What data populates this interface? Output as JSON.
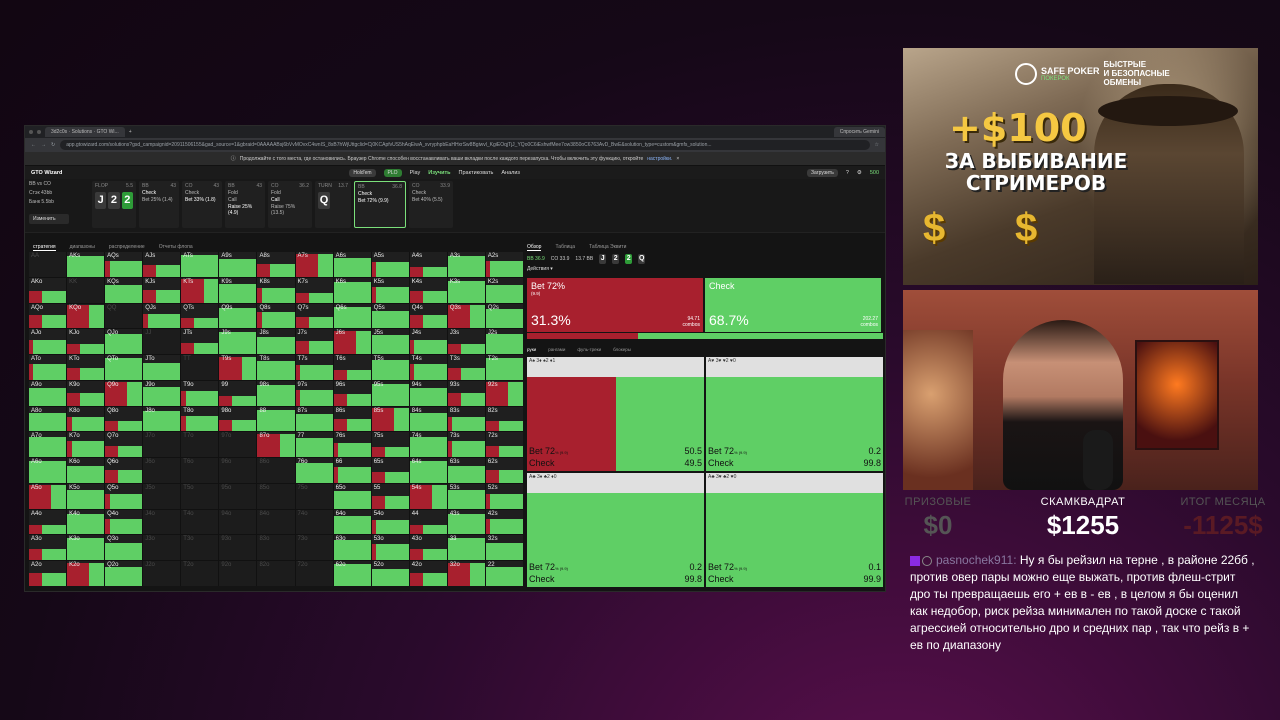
{
  "browser": {
    "tabs": [
      "3d2c0s · Solutions · GTO Wi...",
      "Спросить Gemini"
    ],
    "url": "app.gtowizard.com/solutions?gsd_campaignid=20911506155&gad_source=1&gbraid=0AAAAABsj6bVvMOvxC4wnIS_8sB7hWjUttgclid=Cj0KCApfvUS5hAqEiwA_xvryphpbEaHHxrSw8Bgiwvl_KgiEOqjTjJ_YQo0C6iEshwfMee7ow3850oC6763AvD_BwE&solution_type=custom&gmfs_solution..."
  },
  "infobar": {
    "text": "Продолжайте с того места, где остановились. Браузер Chrome способен восстанавливать ваши вкладки после каждого перезапуска. Чтобы включить эту функцию, откройте",
    "link": "настройки."
  },
  "appnav": {
    "logo": "GTO Wizard",
    "modes": [
      "Hold'em",
      "PLO"
    ],
    "tabs": [
      "Play",
      "Изучить",
      "Практиковать",
      "Анализ"
    ],
    "active_tab": "Изучить",
    "right": [
      "Загрузить",
      "500"
    ]
  },
  "toolbar": {
    "situation": [
      "BB vs CO",
      "Стэк 43bb",
      "Банк 5.5bb"
    ],
    "edit_label": "Изменить",
    "streets": [
      {
        "pos": "FLOP",
        "amount": "5.5",
        "cards": [
          "J",
          "2",
          "2"
        ]
      },
      {
        "pos": "BB",
        "amount": "43",
        "lines": [
          "Check",
          "Bet 25% (1.4)"
        ]
      },
      {
        "pos": "CO",
        "amount": "43",
        "lines": [
          "Check",
          "Bet 33% (1.8)"
        ]
      },
      {
        "pos": "BB",
        "amount": "43",
        "lines": [
          "Fold",
          "Call",
          "Raise 25% (4.9)"
        ]
      },
      {
        "pos": "CO",
        "amount": "36.2",
        "lines": [
          "Fold",
          "Call",
          "Raise 75% (13.5)"
        ]
      },
      {
        "pos": "TURN",
        "amount": "13.7",
        "cards": [
          "Q"
        ]
      },
      {
        "pos": "BB",
        "amount": "36.8",
        "lines": [
          "Check",
          "Bet 72% (9.9)"
        ]
      },
      {
        "pos": "CO",
        "amount": "33.9",
        "lines": [
          "Check",
          "Bet 40% (5.5)"
        ]
      }
    ]
  },
  "left": {
    "tabs": [
      "стратегия",
      "диапазоны",
      "распределение",
      "Отчеты флопа"
    ]
  },
  "matrix": [
    [
      "AA",
      "AKs",
      "AQs",
      "AJs",
      "ATs",
      "A9s",
      "A8s",
      "A7s",
      "A6s",
      "A5s",
      "A4s",
      "A3s",
      "A2s"
    ],
    [
      "AKo",
      "KK",
      "KQs",
      "KJs",
      "KTs",
      "K9s",
      "K8s",
      "K7s",
      "K6s",
      "K5s",
      "K4s",
      "K3s",
      "K2s"
    ],
    [
      "AQo",
      "KQo",
      "QQ",
      "QJs",
      "QTs",
      "Q9s",
      "Q8s",
      "Q7s",
      "Q6s",
      "Q5s",
      "Q4s",
      "Q3s",
      "Q2s"
    ],
    [
      "AJo",
      "KJo",
      "QJo",
      "JJ",
      "JTs",
      "J9s",
      "J8s",
      "J7s",
      "J6s",
      "J5s",
      "J4s",
      "J3s",
      "J2s"
    ],
    [
      "ATo",
      "KTo",
      "QTo",
      "JTo",
      "TT",
      "T9s",
      "T8s",
      "T7s",
      "T6s",
      "T5s",
      "T4s",
      "T3s",
      "T2s"
    ],
    [
      "A9o",
      "K9o",
      "Q9o",
      "J9o",
      "T9o",
      "99",
      "98s",
      "97s",
      "96s",
      "95s",
      "94s",
      "93s",
      "92s"
    ],
    [
      "A8o",
      "K8o",
      "Q8o",
      "J8o",
      "T8o",
      "98o",
      "88",
      "87s",
      "86s",
      "85s",
      "84s",
      "83s",
      "82s"
    ],
    [
      "A7o",
      "K7o",
      "Q7o",
      "J7o",
      "T7o",
      "97o",
      "87o",
      "77",
      "76s",
      "75s",
      "74s",
      "73s",
      "72s"
    ],
    [
      "A6o",
      "K6o",
      "Q6o",
      "J6o",
      "T6o",
      "96o",
      "86o",
      "76o",
      "66",
      "65s",
      "64s",
      "63s",
      "62s"
    ],
    [
      "A5o",
      "K5o",
      "Q5o",
      "J5o",
      "T5o",
      "95o",
      "85o",
      "75o",
      "65o",
      "55",
      "54s",
      "53s",
      "52s"
    ],
    [
      "A4o",
      "K4o",
      "Q4o",
      "J4o",
      "T4o",
      "94o",
      "84o",
      "74o",
      "64o",
      "54o",
      "44",
      "43s",
      "42s"
    ],
    [
      "A3o",
      "K3o",
      "Q3o",
      "J3o",
      "T3o",
      "93o",
      "83o",
      "73o",
      "63o",
      "53o",
      "43o",
      "33",
      "32s"
    ],
    [
      "A2o",
      "K2o",
      "Q2o",
      "J2o",
      "T2o",
      "92o",
      "82o",
      "72o",
      "62o",
      "52o",
      "42o",
      "32o",
      "22"
    ]
  ],
  "right": {
    "tabs": [
      "Обзор",
      "Таблица",
      "Таблица Эквити"
    ],
    "positions": [
      {
        "name": "BB 36.9",
        "sub": "⊙ 13"
      },
      {
        "name": "CO 33.9",
        "sub": "⊙ 13"
      },
      {
        "name": "13.7 BB",
        "sub": "Сделать банк"
      }
    ],
    "board": [
      "J",
      "2",
      "2",
      "Q"
    ],
    "actions_label": "Действия",
    "bet": {
      "name": "Bet 72%",
      "sub": "(9.9)",
      "pct": "31.3%",
      "ev": "94.71",
      "ev_label": "combos"
    },
    "check": {
      "name": "Check",
      "pct": "68.7%",
      "ev": "202.27",
      "ev_label": "combos"
    },
    "subtabs": [
      "руки",
      "рангами",
      "фуль-треки",
      "блокеры"
    ],
    "combos": [
      {
        "suits": "A♠ 3♦  ♠2 ♦1",
        "bet_label": "Bet 72",
        "bet_unit": "% (9.9)",
        "bet_val": "50.5",
        "check_label": "Check",
        "check_val": "49.5",
        "red": 50.5
      },
      {
        "suits": "A♥ 3♥  ♥2 ♥0",
        "bet_label": "Bet 72",
        "bet_unit": "% (9.9)",
        "bet_val": "0.2",
        "check_label": "Check",
        "check_val": "99.8",
        "red": 0
      },
      {
        "suits": "A♣ 3♦  ♣2 ♦0",
        "bet_label": "Bet 72",
        "bet_unit": "% (9.9)",
        "bet_val": "0.2",
        "check_label": "Check",
        "check_val": "99.8",
        "red": 0
      },
      {
        "suits": "A♣ 3♥  ♣2 ♥0",
        "bet_label": "Bet 72",
        "bet_unit": "% (9.9)",
        "bet_val": "0.1",
        "check_label": "Check",
        "check_val": "99.9",
        "red": 0
      }
    ]
  },
  "promo": {
    "brand_top": "SAFE POKER",
    "brand_bottom": "ПОКЕРОК",
    "brand_line1": "БЫСТРЫЕ",
    "brand_line2": "И БЕЗОПАСНЫЕ",
    "brand_line3": "ОБМЕНЫ",
    "amount": "+$100",
    "slogan_line1": "ЗА ВЫБИВАНИЕ",
    "slogan_line2": "СТРИМЕРОВ",
    "dollar": "$"
  },
  "stats": {
    "prize_title": "ПРИЗОВЫЕ",
    "prize_value": "$0",
    "scam_title": "СКАМКВАДРАТ",
    "scam_value": "$1255",
    "month_title": "ИТОГ МЕСЯЦА",
    "month_value": "-1125$"
  },
  "chat": {
    "author": "pasnochek911",
    "message": "Ну я бы рейзил на терне , в районе 22бб , против овер пары можно еще выжать, против флеш-стрит дро ты превращаешь его + ев в - ев , в целом я бы оценил как недобор, риск рейза минимален по такой доске с такой агрессией относительно дро и средних пар , так что рейз в + ев по диапазону"
  }
}
